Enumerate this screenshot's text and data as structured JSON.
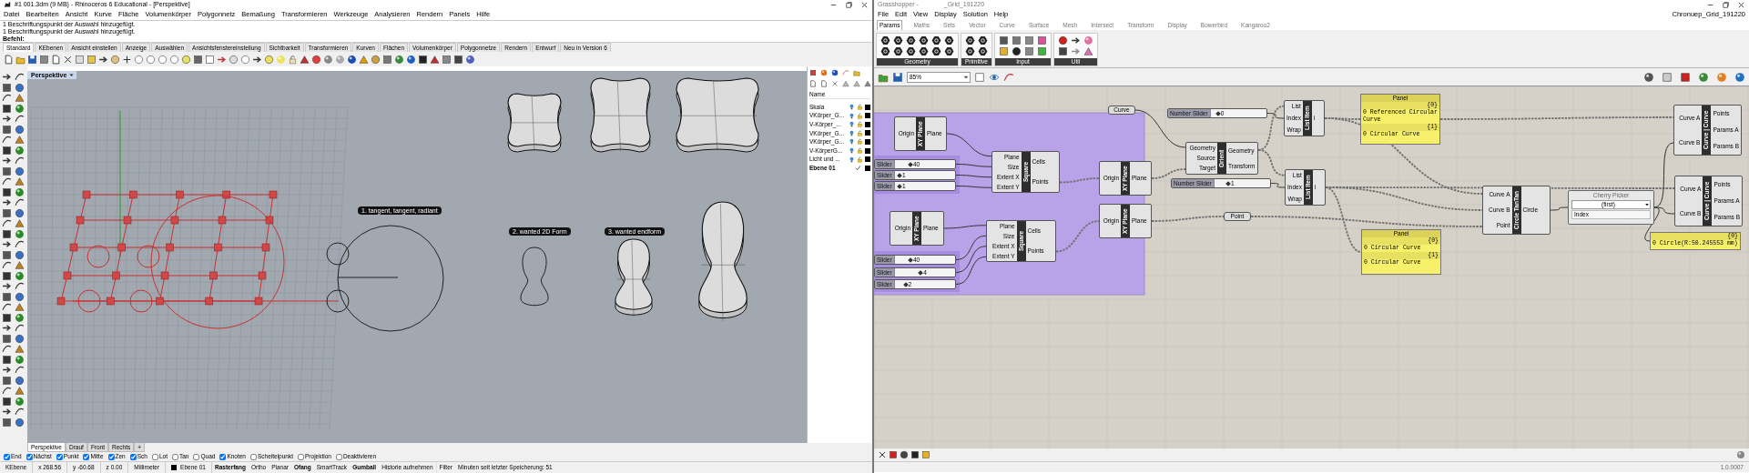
{
  "rhino": {
    "title": "#1 001.3dm (9 MB) - Rhinoceros 6 Educational - [Perspektive]",
    "menu": [
      "Datei",
      "Bearbeiten",
      "Ansicht",
      "Kurve",
      "Fläche",
      "Volumenkörper",
      "Polygonnetz",
      "Bemaßung",
      "Transformieren",
      "Werkzeuge",
      "Analysieren",
      "Rendern",
      "Panels",
      "Hilfe"
    ],
    "command_history": [
      "1 Beschriftungspunkt der Auswahl hinzugefügt.",
      "1 Beschriftungspunkt der Auswahl hinzugefügt."
    ],
    "command_prompt": "Befehl:",
    "toolbar_tabs": [
      {
        "label": "Standard",
        "selected": true
      },
      {
        "label": "KEbenen",
        "selected": false
      },
      {
        "label": "Ansicht einstellen",
        "selected": false
      },
      {
        "label": "Anzeige",
        "selected": false
      },
      {
        "label": "Auswählen",
        "selected": false
      },
      {
        "label": "Ansichtsfenstereinstellung",
        "selected": false
      },
      {
        "label": "Sichtbarkeit",
        "selected": false
      },
      {
        "label": "Transformieren",
        "selected": false
      },
      {
        "label": "Kurven",
        "selected": false
      },
      {
        "label": "Flächen",
        "selected": false
      },
      {
        "label": "Volumenkörper",
        "selected": false
      },
      {
        "label": "Polygonnetze",
        "selected": false
      },
      {
        "label": "Rendern",
        "selected": false
      },
      {
        "label": "Entwurf",
        "selected": false
      },
      {
        "label": "Neu in Version 6",
        "selected": false
      }
    ],
    "viewport": {
      "title": "Perspektive",
      "annotations": [
        "1. tangent, tangent, radiant",
        "2. wanted 2D Form",
        "3. wanted endform"
      ]
    },
    "layers": {
      "header": "Name",
      "items": [
        {
          "name": "Skala",
          "current": false
        },
        {
          "name": "VKörper_G...",
          "current": false
        },
        {
          "name": "V-Körper_...",
          "current": false
        },
        {
          "name": "VKörper_G...",
          "current": false
        },
        {
          "name": "VKörper_G...",
          "current": false
        },
        {
          "name": "V-KörperG...",
          "current": false
        },
        {
          "name": "Licht und ...",
          "current": false
        },
        {
          "name": "Ebene 01",
          "current": true
        }
      ]
    },
    "viewport_tabs": [
      {
        "label": "Perspektive",
        "selected": true
      },
      {
        "label": "Drauf",
        "selected": false
      },
      {
        "label": "Front",
        "selected": false
      },
      {
        "label": "Rechts",
        "selected": false
      }
    ],
    "add_tab": "+",
    "osnaps": [
      {
        "label": "End",
        "checked": true
      },
      {
        "label": "Nächst",
        "checked": true
      },
      {
        "label": "Punkt",
        "checked": true
      },
      {
        "label": "Mitte",
        "checked": true
      },
      {
        "label": "Zen",
        "checked": true
      },
      {
        "label": "Sch",
        "checked": true
      },
      {
        "label": "Lot",
        "checked": false
      },
      {
        "label": "Tan",
        "checked": false
      },
      {
        "label": "Quad",
        "checked": false
      },
      {
        "label": "Knoten",
        "checked": true
      },
      {
        "label": "Scheitelpunkt",
        "checked": false
      },
      {
        "label": "Projektion",
        "checked": false
      },
      {
        "label": "Deaktivieren",
        "checked": false
      }
    ],
    "status_bar": {
      "cplane": "KEbene",
      "x": "x 268.56",
      "y": "y -60.68",
      "z": "z 0.00",
      "units": "Millimeter",
      "layer": "Ebene 01",
      "toggles": [
        {
          "label": "Rasterfang",
          "on": true
        },
        {
          "label": "Ortho",
          "on": false
        },
        {
          "label": "Planar",
          "on": false
        },
        {
          "label": "Ofang",
          "on": true
        },
        {
          "label": "SmartTrack",
          "on": false
        },
        {
          "label": "Gumball",
          "on": true
        },
        {
          "label": "Historie aufnehmen",
          "on": false
        }
      ],
      "filter": "Filter",
      "save_info": "Minuten seit letzter Speicherung: 51"
    }
  },
  "grasshopper": {
    "title": "Grasshopper -",
    "document_name": "_Grid_191220",
    "menu": [
      "File",
      "Edit",
      "View",
      "Display",
      "Solution",
      "Help"
    ],
    "file_label": "Chronuep_Grid_191220",
    "tabs": [
      {
        "label": "Params",
        "selected": true
      },
      {
        "label": "Maths",
        "selected": false
      },
      {
        "label": "Sets",
        "selected": false
      },
      {
        "label": "Vector",
        "selected": false
      },
      {
        "label": "Curve",
        "selected": false
      },
      {
        "label": "Surface",
        "selected": false
      },
      {
        "label": "Mesh",
        "selected": false
      },
      {
        "label": "Intersect",
        "selected": false
      },
      {
        "label": "Transform",
        "selected": false
      },
      {
        "label": "Display",
        "selected": false
      },
      {
        "label": "Bowerbird",
        "selected": false
      },
      {
        "label": "Kangaroo2",
        "selected": false
      }
    ],
    "ribbon_groups": [
      "Geometry",
      "Primitive",
      "Input",
      "Util"
    ],
    "zoom": "85%",
    "components": [
      {
        "kind": "component",
        "name": "XY Plane",
        "inputs": [
          "Origin"
        ],
        "outputs": [
          "Plane"
        ]
      },
      {
        "kind": "slider",
        "label": "Slider",
        "value": "40",
        "level": 0.23
      },
      {
        "kind": "slider",
        "label": "Slider",
        "value": "1",
        "level": 0.05
      },
      {
        "kind": "slider",
        "label": "Slider",
        "value": "1",
        "level": 0.05
      },
      {
        "kind": "component",
        "name": "Square",
        "inputs": [
          "Plane",
          "Size",
          "Extent X",
          "Extent Y"
        ],
        "outputs": [
          "Cells",
          "Points"
        ]
      },
      {
        "kind": "component",
        "name": "XY Plane",
        "inputs": [
          "Origin"
        ],
        "outputs": [
          "Plane"
        ]
      },
      {
        "kind": "component",
        "name": "XY Plane",
        "inputs": [
          "Origin"
        ],
        "outputs": [
          "Plane"
        ]
      },
      {
        "kind": "component",
        "name": "Square",
        "inputs": [
          "Plane",
          "Size",
          "Extent X",
          "Extent Y"
        ],
        "outputs": [
          "Cells",
          "Points"
        ]
      },
      {
        "kind": "slider",
        "label": "Slider",
        "value": "40",
        "level": 0.23
      },
      {
        "kind": "slider",
        "label": "Slider",
        "value": "4",
        "level": 0.4
      },
      {
        "kind": "slider",
        "label": "Slider",
        "value": "2",
        "level": 0.15
      },
      {
        "kind": "component",
        "name": "XY Plane",
        "inputs": [
          "Origin"
        ],
        "outputs": [
          "Plane"
        ]
      },
      {
        "kind": "param",
        "label": "Curve"
      },
      {
        "kind": "slider",
        "label": "Number Slider",
        "value": "0",
        "level": 0.1
      },
      {
        "kind": "component",
        "name": "Orient",
        "inputs": [
          "Geometry",
          "Source",
          "Target"
        ],
        "outputs": [
          "Geometry",
          "Transform"
        ]
      },
      {
        "kind": "slider",
        "label": "Number Slider",
        "value": "1",
        "level": 0.22
      },
      {
        "kind": "component",
        "name": "List Item",
        "inputs": [
          "List",
          "Index",
          "Wrap"
        ],
        "outputs": [
          "i"
        ]
      },
      {
        "kind": "component",
        "name": "List Item",
        "inputs": [
          "List",
          "Index",
          "Wrap"
        ],
        "outputs": [
          "i"
        ]
      },
      {
        "kind": "param",
        "label": "Point"
      },
      {
        "kind": "panel",
        "title": "Panel",
        "branches": [
          {
            "path": "{0}",
            "items": [
              "0 Referenced Circular Curve"
            ]
          },
          {
            "path": "{1}",
            "items": [
              "0 Circular Curve"
            ]
          }
        ]
      },
      {
        "kind": "panel",
        "title": "Panel",
        "branches": [
          {
            "path": "{0}",
            "items": [
              "0 Circular Curve"
            ]
          },
          {
            "path": "{1}",
            "items": [
              "0 Circular Curve"
            ]
          }
        ]
      },
      {
        "kind": "component",
        "name": "Circle TanTan",
        "inputs": [
          "Curve A",
          "Curve B",
          "Point"
        ],
        "outputs": [
          "Circle"
        ]
      },
      {
        "kind": "cherry_picker",
        "title": "Cherry Picker",
        "option": "(first)",
        "index_label": "Index"
      },
      {
        "kind": "component",
        "name": "Curve | Curve",
        "inputs": [
          "Curve A",
          "Curve B"
        ],
        "outputs": [
          "Points",
          "Params A",
          "Params B"
        ]
      },
      {
        "kind": "component",
        "name": "Curve | Curve",
        "inputs": [
          "Curve A",
          "Curve B"
        ],
        "outputs": [
          "Points",
          "Params A",
          "Params B"
        ]
      },
      {
        "kind": "panel",
        "branches": [
          {
            "path": "{0}",
            "items": [
              "0 Circle(R:50.245553 mm)"
            ]
          }
        ]
      }
    ],
    "version": "1.0.0007"
  }
}
